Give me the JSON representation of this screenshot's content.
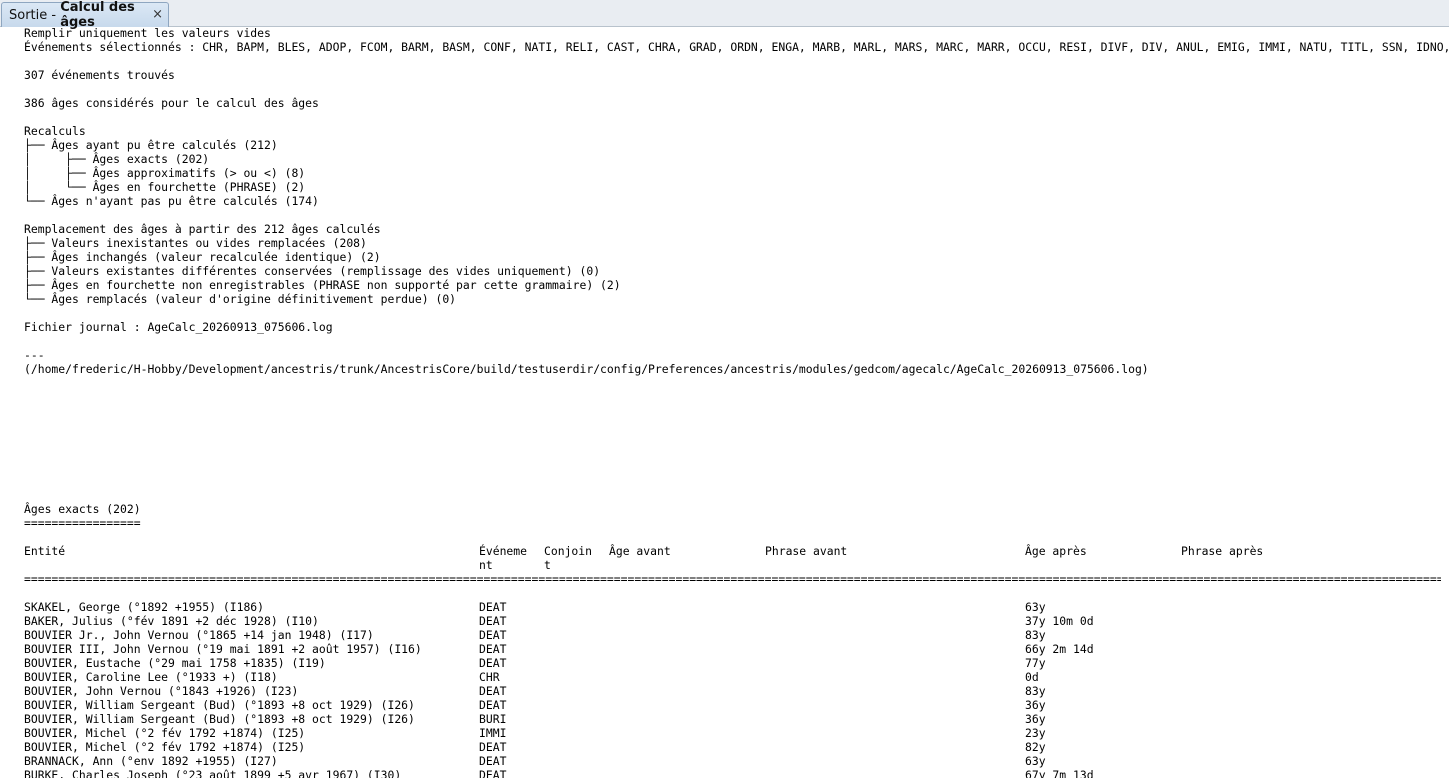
{
  "tab": {
    "prefix": "Sortie - ",
    "title": "Calcul des âges",
    "close": "×"
  },
  "report": {
    "line1": "Remplir uniquement les valeurs vides",
    "line2": "Événements sélectionnés : CHR, BAPM, BLES, ADOP, FCOM, BARM, BASM, CONF, NATI, RELI, CAST, CHRA, GRAD, ORDN, ENGA, MARB, MARL, MARS, MARC, MARR, OCCU, RESI, DIVF, DIV, ANUL, EMIG, IMMI, NATU, TITL, SSN, IDNO, DSCR, EDUC",
    "found": "307 événements trouvés",
    "considered": "386 âges considérés pour le calcul des âges",
    "recalc_title": "Recalculs",
    "recalc1": "├── Âges ayant pu être calculés (212)",
    "recalc2": "│     ├── Âges exacts (202)",
    "recalc3": "│     ├── Âges approximatifs (> ou <) (8)",
    "recalc4": "│     └── Âges en fourchette (PHRASE) (2)",
    "recalc5": "└── Âges n'ayant pas pu être calculés (174)",
    "repl_title": "Remplacement des âges à partir des 212 âges calculés",
    "repl1": "├── Valeurs inexistantes ou vides remplacées (208)",
    "repl2": "├── Âges inchangés (valeur recalculée identique) (2)",
    "repl3": "├── Valeurs existantes différentes conservées (remplissage des vides uniquement) (0)",
    "repl4": "├── Âges en fourchette non enregistrables (PHRASE non supporté par cette grammaire) (2)",
    "repl5": "└── Âges remplacés (valeur d'origine définitivement perdue) (0)",
    "journal": "Fichier journal : AgeCalc_20260913_075606.log",
    "sep": "---",
    "path": "(/home/frederic/H-Hobby/Development/ancestris/trunk/AncestrisCore/build/testuserdir/config/Preferences/ancestris/modules/gedcom/agecalc/AgeCalc_20260913_075606.log)",
    "exact_title": "Âges exacts (202)",
    "exact_underline": "=================",
    "rule": "=============================================================================================================================================================================================================================================="
  },
  "table": {
    "headers": {
      "entity": "Entité",
      "event_a": "Événeme",
      "event_b": "nt",
      "spouse_a": "Conjoin",
      "spouse_b": "t",
      "age_before": "Âge avant",
      "phrase_before": "Phrase avant",
      "age_after": "Âge après",
      "phrase_after": "Phrase après"
    },
    "rows": [
      {
        "entity": "SKAKEL, George (°1892 +1955) (I186)",
        "event": "DEAT",
        "age_after": "63y"
      },
      {
        "entity": "BAKER, Julius (°fév 1891 +2 déc 1928) (I10)",
        "event": "DEAT",
        "age_after": "37y 10m 0d"
      },
      {
        "entity": "BOUVIER Jr., John Vernou (°1865 +14 jan 1948) (I17)",
        "event": "DEAT",
        "age_after": "83y"
      },
      {
        "entity": "BOUVIER III, John Vernou (°19 mai 1891 +2 août 1957) (I16)",
        "event": "DEAT",
        "age_after": "66y 2m 14d"
      },
      {
        "entity": "BOUVIER, Eustache (°29 mai 1758 +1835) (I19)",
        "event": "DEAT",
        "age_after": "77y"
      },
      {
        "entity": "BOUVIER, Caroline Lee (°1933 +) (I18)",
        "event": "CHR",
        "age_after": "0d"
      },
      {
        "entity": "BOUVIER, John Vernou (°1843 +1926) (I23)",
        "event": "DEAT",
        "age_after": "83y"
      },
      {
        "entity": "BOUVIER, William Sergeant (Bud) (°1893 +8 oct 1929) (I26)",
        "event": "DEAT",
        "age_after": "36y"
      },
      {
        "entity": "BOUVIER, William Sergeant (Bud) (°1893 +8 oct 1929) (I26)",
        "event": "BURI",
        "age_after": "36y"
      },
      {
        "entity": "BOUVIER, Michel (°2 fév 1792 +1874) (I25)",
        "event": "IMMI",
        "age_after": "23y"
      },
      {
        "entity": "BOUVIER, Michel (°2 fév 1792 +1874) (I25)",
        "event": "DEAT",
        "age_after": "82y"
      },
      {
        "entity": "BRANNACK, Ann (°env 1892 +1955) (I27)",
        "event": "DEAT",
        "age_after": "63y"
      },
      {
        "entity": "BURKE, Charles Joseph (°23 août 1899 +5 avr 1967) (I30)",
        "event": "DEAT",
        "age_after": "67y 7m 13d"
      }
    ]
  }
}
